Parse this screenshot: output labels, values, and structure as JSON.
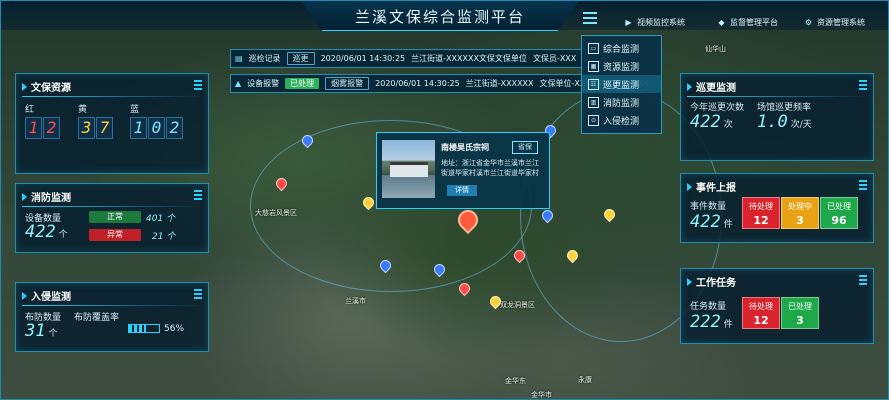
{
  "header": {
    "title": "兰溪文保综合监测平台",
    "nav": [
      {
        "label": "视频监控系统",
        "icon": "video-icon"
      },
      {
        "label": "监督管理平台",
        "icon": "shield-icon"
      },
      {
        "label": "资源管理系统",
        "icon": "gear-icon"
      }
    ]
  },
  "notices": [
    {
      "icon": "clipboard-icon",
      "name": "巡检记录",
      "tag": "巡更",
      "tag_color": "#1e5f8a",
      "time": "2020/06/01 14:30:25",
      "text": "兰江街道-XXXXXX文保文保单位",
      "person": "文保员-XXX"
    },
    {
      "icon": "warning-icon",
      "name": "设备报警",
      "tag": "已处理",
      "tag_color": "#2fb05a",
      "tag2": "烟雾报警",
      "time": "2020/06/01 14:30:25",
      "text": "兰江街道-XXXXXX",
      "person": "文保单位-XXXXXXXXXXX(XX"
    }
  ],
  "dropdown_menu": [
    {
      "label": "综合监测",
      "icon": "monitor-icon",
      "active": false
    },
    {
      "label": "资源监测",
      "icon": "resource-icon",
      "active": false
    },
    {
      "label": "巡更监测",
      "icon": "patrol-icon",
      "active": true
    },
    {
      "label": "消防监测",
      "icon": "fire-icon",
      "active": false
    },
    {
      "label": "入侵检测",
      "icon": "intrusion-icon",
      "active": false
    }
  ],
  "heritage": {
    "title": "文保资源",
    "labels": [
      "红",
      "黄",
      "蓝"
    ],
    "red": [
      "1",
      "2"
    ],
    "yellow": [
      "3",
      "7"
    ],
    "blue": [
      "1",
      "0",
      "2"
    ],
    "colors": {
      "red": "#ff4a4a",
      "yellow": "#ffd23a",
      "blue": "#7fe6ff"
    }
  },
  "fire": {
    "title": "消防监测",
    "label": "设备数量",
    "count": "422",
    "unit": "个",
    "normal_label": "正常",
    "normal_value": "401",
    "abnormal_label": "异常",
    "abnormal_value": "21",
    "unit_small": "个"
  },
  "intrusion": {
    "title": "入侵监测",
    "count_label": "布防数量",
    "count": "31",
    "unit": "个",
    "coverage_label": "布防覆盖率",
    "coverage_percent": "56%",
    "coverage_value": 0.56
  },
  "patrol": {
    "title": "巡更监测",
    "today_label": "今年巡更次数",
    "today": "422",
    "today_unit": "次",
    "freq_label": "场馆巡更频率",
    "freq": "1.0",
    "freq_unit": "次/天"
  },
  "events": {
    "title": "事件上报",
    "count_label": "事件数量",
    "count": "422",
    "unit": "件",
    "boxes": [
      {
        "label": "待处理",
        "value": "12",
        "color": "#d9232d"
      },
      {
        "label": "处理中",
        "value": "3",
        "color": "#e8a213"
      },
      {
        "label": "已处理",
        "value": "96",
        "color": "#1ea84a"
      }
    ]
  },
  "tasks": {
    "title": "工作任务",
    "count_label": "任务数量",
    "count": "222",
    "unit": "件",
    "boxes": [
      {
        "label": "待处理",
        "value": "12",
        "color": "#d9232d"
      },
      {
        "label": "已处理",
        "value": "3",
        "color": "#1ea84a"
      }
    ]
  },
  "popup": {
    "name": "南楼吴氏宗祠",
    "tag": "省保",
    "address": "地址：浙江省金华市兰溪市兰江街道毕家村溪市兰江街道毕家村",
    "detail_button": "详情"
  },
  "map_labels": [
    {
      "text": "大慈岩风景区"
    },
    {
      "text": "兰溪市"
    },
    {
      "text": "双龙洞景区"
    },
    {
      "text": "金华东"
    },
    {
      "text": "金华市"
    },
    {
      "text": "仙华山"
    },
    {
      "text": "永康"
    }
  ]
}
